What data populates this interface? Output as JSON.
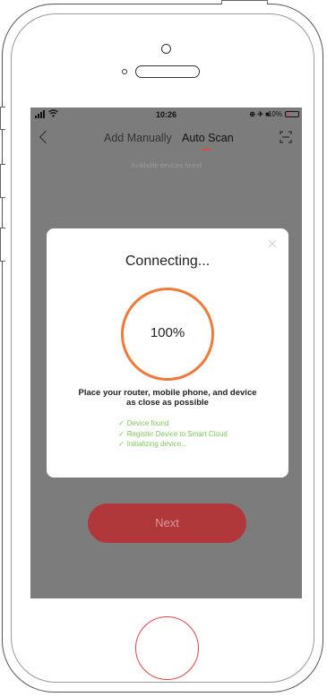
{
  "status_bar": {
    "time": "10:26",
    "status_icons": "⊕ ✈ ■",
    "battery": "10%"
  },
  "nav": {
    "tabs": [
      {
        "label": "Add Manually",
        "active": false
      },
      {
        "label": "Auto Scan",
        "active": true
      }
    ],
    "accent_color": "#e0464a"
  },
  "subtitle": "Available devices found",
  "dialog": {
    "title": "Connecting...",
    "progress_label": "100%",
    "progress_value": 1.0,
    "instruction_line1": "Place your router, mobile phone, and device",
    "instruction_line2": "as close as possible",
    "steps": [
      {
        "label": "Device found",
        "done": true
      },
      {
        "label": "Register Device to Smart Cloud",
        "done": true
      },
      {
        "label": "Initializing device...",
        "done": true
      }
    ],
    "ring_color": "#f07a3c",
    "step_color": "#7cc85c"
  },
  "next_button": {
    "label": "Next"
  },
  "icons": [
    "back-icon",
    "scan-icon",
    "close-icon",
    "check-icon",
    "signal-icon",
    "wifi-icon",
    "battery-icon"
  ]
}
